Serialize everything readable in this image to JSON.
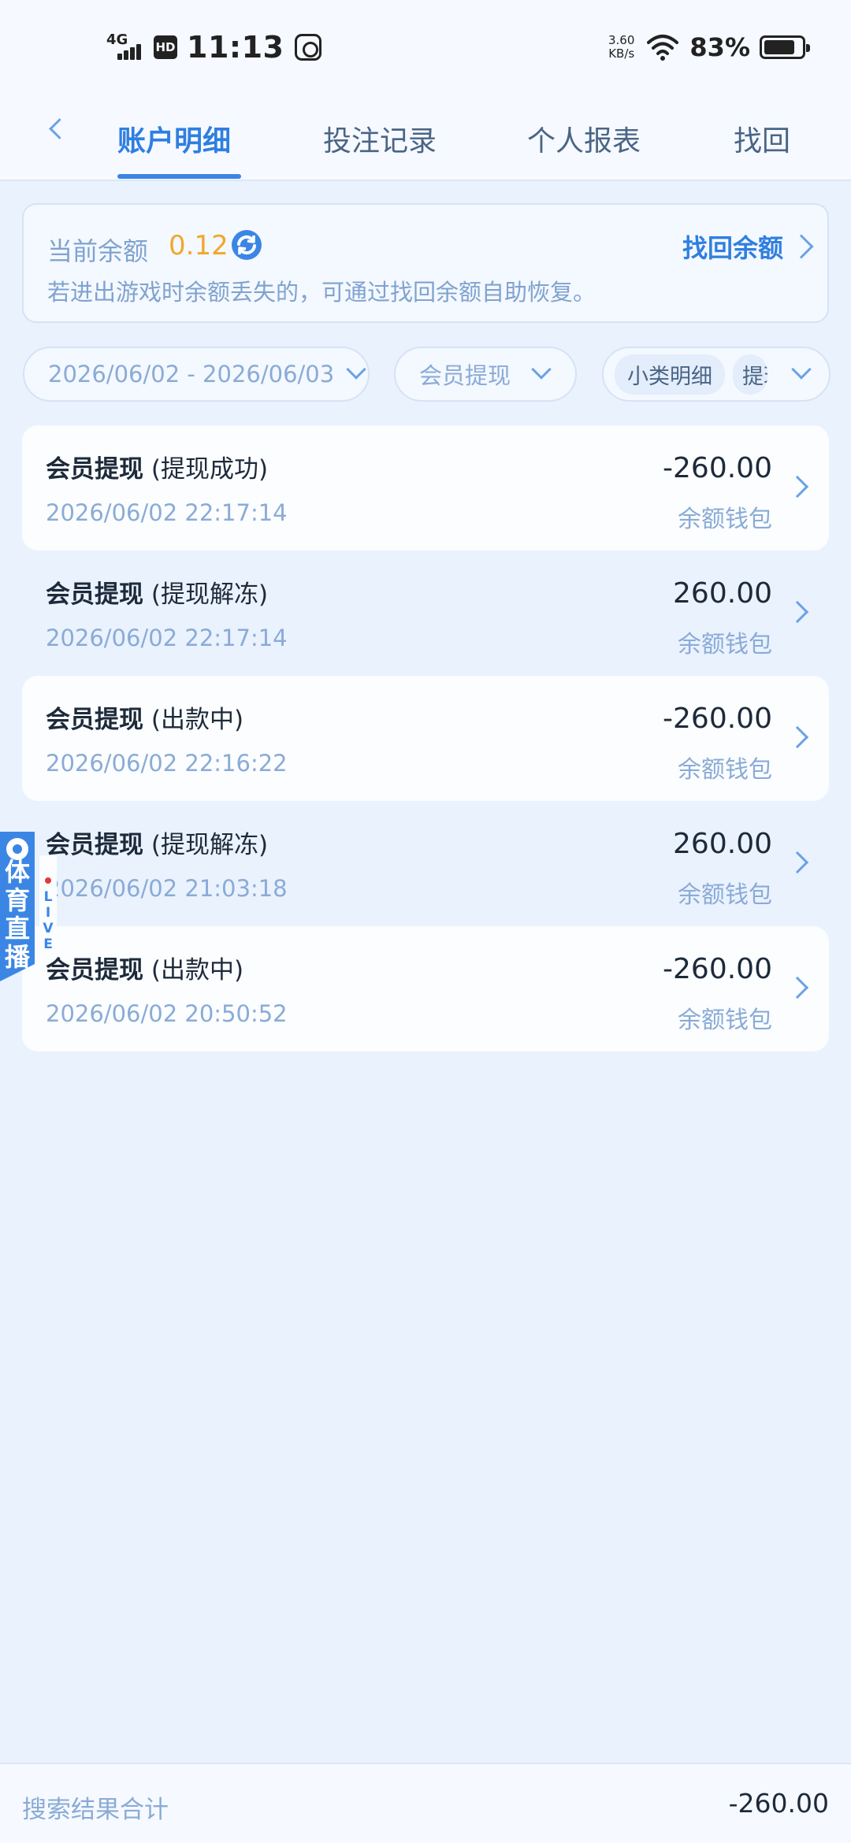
{
  "status_bar": {
    "network": "4G",
    "hd": "HD",
    "time": "11:13",
    "speed_value": "3.60",
    "speed_unit": "KB/s",
    "battery": "83%"
  },
  "tabs": [
    {
      "label": "账户明细",
      "active": true
    },
    {
      "label": "投注记录",
      "active": false
    },
    {
      "label": "个人报表",
      "active": false
    },
    {
      "label": "找回",
      "active": false
    }
  ],
  "balance": {
    "label": "当前余额",
    "value": "0.12",
    "recover_label": "找回余额",
    "tip": "若进出游戏时余额丢失的，可通过找回余额自助恢复。"
  },
  "filters": {
    "date_range": "2026/06/02 - 2026/06/03",
    "type": "会员提现",
    "sub_chip": "小类明细",
    "sub_chip_cut": "提现"
  },
  "transactions": [
    {
      "type": "会员提现",
      "status": "(提现成功)",
      "datetime": "2026/06/02 22:17:14",
      "amount": "-260.00",
      "wallet": "余额钱包"
    },
    {
      "type": "会员提现",
      "status": "(提现解冻)",
      "datetime": "2026/06/02 22:17:14",
      "amount": "260.00",
      "wallet": "余额钱包"
    },
    {
      "type": "会员提现",
      "status": "(出款中)",
      "datetime": "2026/06/02 22:16:22",
      "amount": "-260.00",
      "wallet": "余额钱包"
    },
    {
      "type": "会员提现",
      "status": "(提现解冻)",
      "datetime": "2026/06/02 21:03:18",
      "amount": "260.00",
      "wallet": "余额钱包"
    },
    {
      "type": "会员提现",
      "status": "(出款中)",
      "datetime": "2026/06/02 20:50:52",
      "amount": "-260.00",
      "wallet": "余额钱包"
    }
  ],
  "live_badge": {
    "text": "体育直播",
    "live": "LIVE"
  },
  "footer": {
    "label": "搜索结果合计",
    "total": "-260.00"
  },
  "colors": {
    "accent": "#2f7fe0",
    "balance_value": "#f1a72b",
    "muted": "#8aabd6",
    "background": "#eaf2fe"
  },
  "icons": [
    "refresh-icon",
    "chevron-right-icon",
    "chevron-down-icon",
    "back-arrow-icon",
    "wifi-icon",
    "battery-icon",
    "signal-icon"
  ]
}
